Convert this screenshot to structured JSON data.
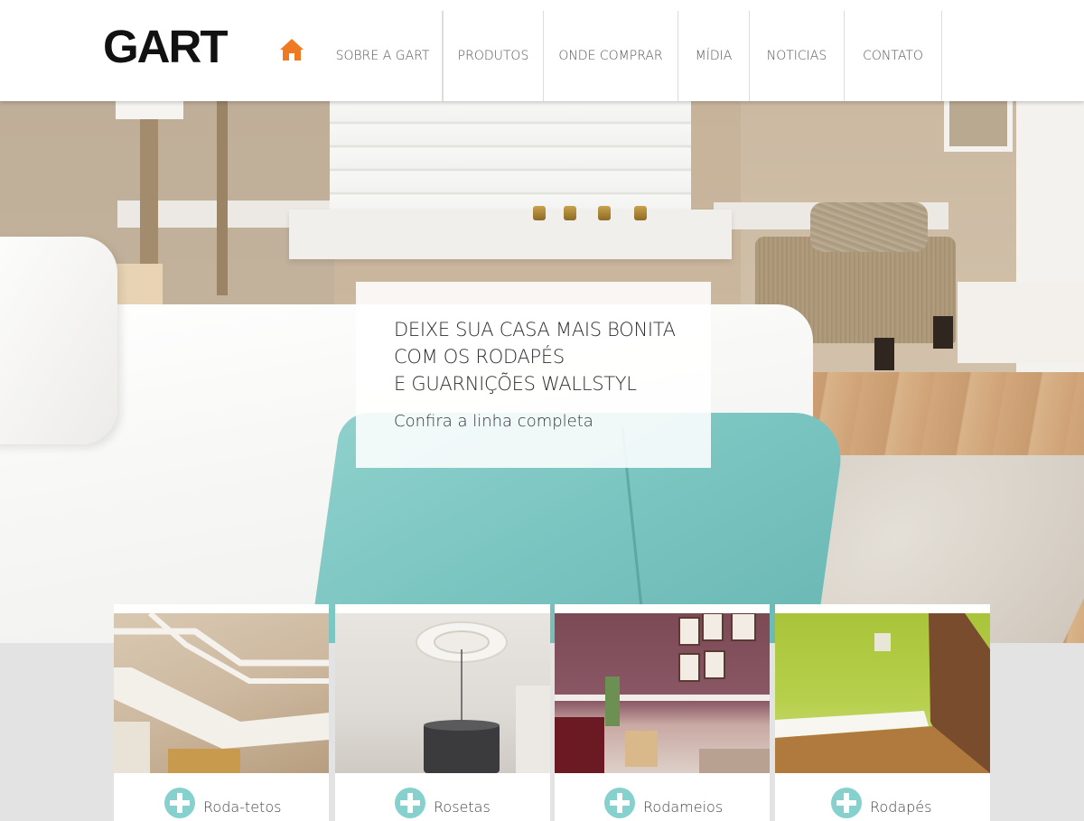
{
  "header": {
    "logo": "GART",
    "home_icon": "home-icon",
    "nav": [
      {
        "label": "SOBRE A GART"
      },
      {
        "label": "PRODUTOS"
      },
      {
        "label": "ONDE COMPRAR"
      },
      {
        "label": "MÍDIA"
      },
      {
        "label": "NOTICIAS"
      },
      {
        "label": "CONTATO"
      }
    ],
    "accent_color": "#f07a22"
  },
  "hero": {
    "title_lines": [
      "DEIXE SUA CASA MAIS BONITA",
      "COM OS RODAPÉS",
      "E GUARNIÇÕES WALLSTYL"
    ],
    "link": "Confira a linha completa"
  },
  "products": [
    {
      "label": "Roda-tetos",
      "icon": "plus-circle-icon"
    },
    {
      "label": "Rosetas",
      "icon": "plus-circle-icon"
    },
    {
      "label": "Rodameios",
      "icon": "plus-circle-icon"
    },
    {
      "label": "Rodapés",
      "icon": "plus-circle-icon"
    }
  ],
  "colors": {
    "plus_icon": "#86d0cd",
    "background": "#e3e3e3"
  }
}
